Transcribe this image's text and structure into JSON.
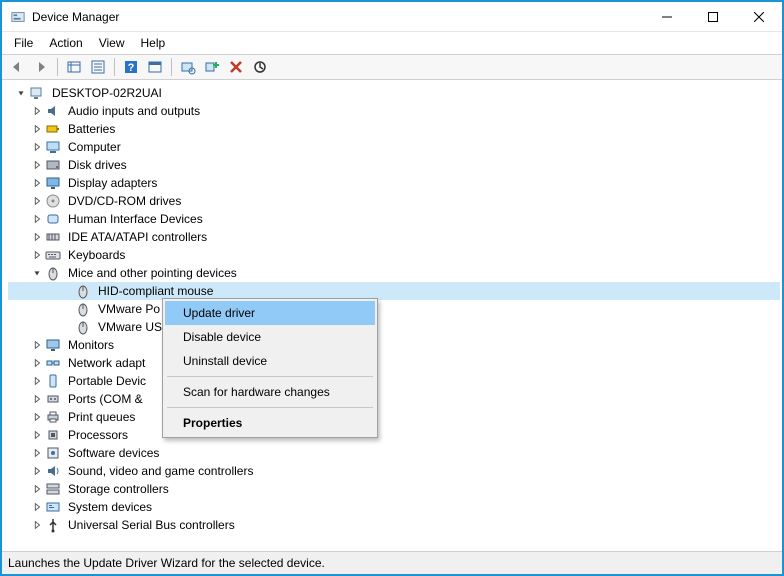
{
  "window": {
    "title": "Device Manager"
  },
  "menubar": {
    "items": [
      "File",
      "Action",
      "View",
      "Help"
    ]
  },
  "toolbar": {
    "buttons": [
      {
        "name": "back-icon"
      },
      {
        "name": "forward-icon"
      },
      {
        "sep": true
      },
      {
        "name": "show-hidden-icon"
      },
      {
        "name": "properties-icon"
      },
      {
        "sep": true
      },
      {
        "name": "help-icon"
      },
      {
        "name": "details-icon"
      },
      {
        "sep": true
      },
      {
        "name": "scan-hardware-icon"
      },
      {
        "name": "add-legacy-icon"
      },
      {
        "name": "uninstall-icon"
      },
      {
        "name": "update-driver-icon"
      }
    ]
  },
  "tree": {
    "root": {
      "label": "DESKTOP-02R2UAI",
      "expanded": true
    },
    "categories": [
      {
        "label": "Audio inputs and outputs",
        "icon": "audio-icon",
        "expanded": false
      },
      {
        "label": "Batteries",
        "icon": "battery-icon",
        "expanded": false
      },
      {
        "label": "Computer",
        "icon": "computer-icon",
        "expanded": false
      },
      {
        "label": "Disk drives",
        "icon": "disk-icon",
        "expanded": false
      },
      {
        "label": "Display adapters",
        "icon": "display-icon",
        "expanded": false
      },
      {
        "label": "DVD/CD-ROM drives",
        "icon": "dvd-icon",
        "expanded": false
      },
      {
        "label": "Human Interface Devices",
        "icon": "hid-icon",
        "expanded": false
      },
      {
        "label": "IDE ATA/ATAPI controllers",
        "icon": "ide-icon",
        "expanded": false
      },
      {
        "label": "Keyboards",
        "icon": "keyboard-icon",
        "expanded": false
      },
      {
        "label": "Mice and other pointing devices",
        "icon": "mouse-icon",
        "expanded": true,
        "children": [
          {
            "label": "HID-compliant mouse",
            "icon": "mouse-icon",
            "selected": true
          },
          {
            "label": "VMware Pointing Device",
            "icon": "mouse-icon",
            "truncated": "VMware Po"
          },
          {
            "label": "VMware USB Pointing Device",
            "icon": "mouse-icon",
            "truncated": "VMware US"
          }
        ]
      },
      {
        "label": "Monitors",
        "icon": "monitor-icon",
        "expanded": false
      },
      {
        "label": "Network adapters",
        "icon": "network-icon",
        "expanded": false,
        "truncated": "Network adapt"
      },
      {
        "label": "Portable Devices",
        "icon": "portable-icon",
        "expanded": false,
        "truncated": "Portable Devic"
      },
      {
        "label": "Ports (COM & LPT)",
        "icon": "ports-icon",
        "expanded": false,
        "truncated": "Ports (COM &"
      },
      {
        "label": "Print queues",
        "icon": "print-icon",
        "expanded": false
      },
      {
        "label": "Processors",
        "icon": "cpu-icon",
        "expanded": false
      },
      {
        "label": "Software devices",
        "icon": "software-icon",
        "expanded": false
      },
      {
        "label": "Sound, video and game controllers",
        "icon": "sound-icon",
        "expanded": false
      },
      {
        "label": "Storage controllers",
        "icon": "storage-icon",
        "expanded": false
      },
      {
        "label": "System devices",
        "icon": "system-icon",
        "expanded": false
      },
      {
        "label": "Universal Serial Bus controllers",
        "icon": "usb-icon",
        "expanded": false
      }
    ]
  },
  "context_menu": {
    "items": [
      {
        "label": "Update driver",
        "highlight": true
      },
      {
        "label": "Disable device"
      },
      {
        "label": "Uninstall device"
      },
      {
        "sep": true
      },
      {
        "label": "Scan for hardware changes"
      },
      {
        "sep": true
      },
      {
        "label": "Properties",
        "bold": true
      }
    ]
  },
  "statusbar": {
    "text": "Launches the Update Driver Wizard for the selected device."
  }
}
